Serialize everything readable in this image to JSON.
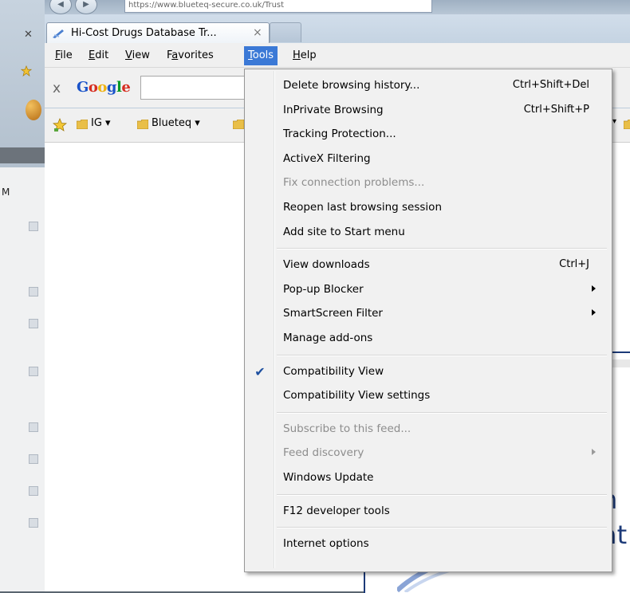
{
  "background": {
    "menu_initial": "M"
  },
  "browser": {
    "url_text": "https://www.blueteq-secure.co.uk/Trust",
    "tab": {
      "title": "Hi-Cost Drugs Database Tr...",
      "close": "×"
    },
    "menubar": [
      {
        "key": "file",
        "label": "File"
      },
      {
        "key": "edit",
        "label": "Edit"
      },
      {
        "key": "view",
        "label": "View"
      },
      {
        "key": "favorites",
        "label": "Favorites"
      },
      {
        "key": "tools",
        "label": "Tools"
      },
      {
        "key": "help",
        "label": "Help"
      }
    ],
    "google_toolbar": {
      "close": "x",
      "logo": "Google",
      "search_value": ""
    },
    "favorites_bar": [
      {
        "label": "IG ▾"
      },
      {
        "label": "Blueteq ▾"
      }
    ],
    "page": {
      "fragment1": "h",
      "fragment2": "at"
    }
  },
  "tools_menu": {
    "items": [
      {
        "type": "item",
        "label": "Delete browsing history...",
        "shortcut": "Ctrl+Shift+Del",
        "enabled": true
      },
      {
        "type": "item",
        "label": "InPrivate Browsing",
        "shortcut": "Ctrl+Shift+P",
        "enabled": true
      },
      {
        "type": "item",
        "label": "Tracking Protection...",
        "enabled": true
      },
      {
        "type": "item",
        "label": "ActiveX Filtering",
        "enabled": true
      },
      {
        "type": "item",
        "label": "Fix connection problems...",
        "enabled": false
      },
      {
        "type": "item",
        "label": "Reopen last browsing session",
        "enabled": true
      },
      {
        "type": "item",
        "label": "Add site to Start menu",
        "enabled": true
      },
      {
        "type": "separator"
      },
      {
        "type": "item",
        "label": "View downloads",
        "shortcut": "Ctrl+J",
        "enabled": true
      },
      {
        "type": "item",
        "label": "Pop-up Blocker",
        "submenu": true,
        "enabled": true
      },
      {
        "type": "item",
        "label": "SmartScreen Filter",
        "submenu": true,
        "enabled": true
      },
      {
        "type": "item",
        "label": "Manage add-ons",
        "enabled": true
      },
      {
        "type": "separator"
      },
      {
        "type": "item",
        "label": "Compatibility View",
        "checked": true,
        "enabled": true
      },
      {
        "type": "item",
        "label": "Compatibility View settings",
        "enabled": true
      },
      {
        "type": "separator"
      },
      {
        "type": "item",
        "label": "Subscribe to this feed...",
        "enabled": false
      },
      {
        "type": "item",
        "label": "Feed discovery",
        "submenu": true,
        "enabled": false
      },
      {
        "type": "item",
        "label": "Windows Update",
        "enabled": true
      },
      {
        "type": "separator"
      },
      {
        "type": "item",
        "label": "F12 developer tools",
        "enabled": true
      },
      {
        "type": "separator"
      },
      {
        "type": "item",
        "label": "Internet options",
        "enabled": true
      }
    ],
    "check_glyph": "✔"
  },
  "colors": {
    "menu_highlight": "#3b79d6",
    "menu_background": "#f1f1f1",
    "disabled_text": "#8d8d8d",
    "check_color": "#1e50a0"
  }
}
